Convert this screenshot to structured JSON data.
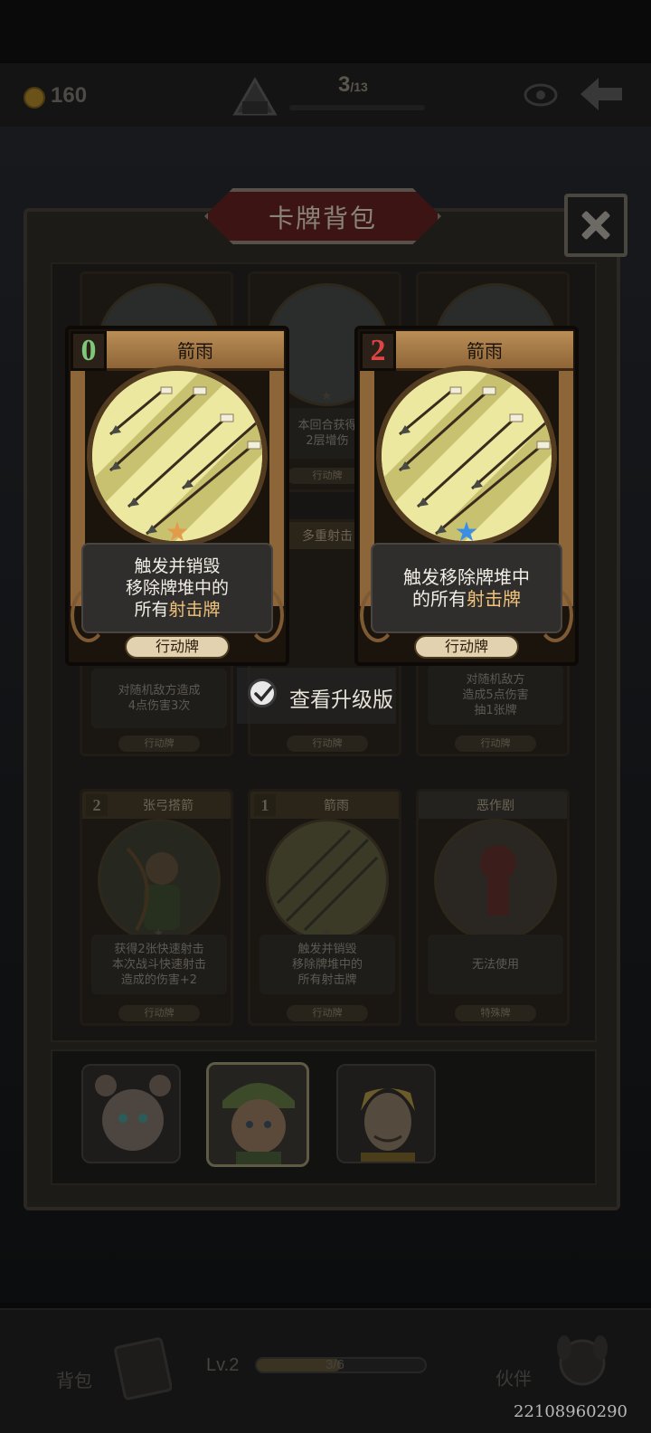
{
  "hud": {
    "coins": "160",
    "floor_current": "3",
    "floor_total": "/13",
    "icons": [
      "coin-icon",
      "map-icon",
      "eye-icon",
      "back-arrow-icon"
    ]
  },
  "panel": {
    "title": "卡牌背包",
    "close_icon": "close-icon"
  },
  "compare_cards": [
    {
      "name": "箭雨",
      "cost": "0",
      "cost_color": "#7ec87a",
      "star_color": "#e39a4a",
      "desc": [
        "触发并销毁",
        "移除牌堆中的",
        "所有"
      ],
      "highlight": "射击牌",
      "type": "行动牌"
    },
    {
      "name": "箭雨",
      "cost": "2",
      "cost_color": "#e04545",
      "star_color": "#3a8ee6",
      "desc": [
        "触发移除牌堆中",
        "的所有"
      ],
      "highlight": "射击牌",
      "type": "行动牌"
    }
  ],
  "upgrade_toggle": {
    "label": "查看升级版",
    "checked": true
  },
  "background_cards": {
    "row1_mid": {
      "desc": [
        "本回合获得",
        "2层增伤"
      ],
      "type": "行动牌"
    },
    "row2_mid_name": "多重射击",
    "row2_left": {
      "desc": [
        "对随机敌方造成",
        "4点伤害3次"
      ],
      "type": "行动牌"
    },
    "row2_mid_type": "行动牌",
    "row2_right": {
      "desc": [
        "对随机敌方",
        "造成5点伤害",
        "抽1张牌"
      ],
      "type": "行动牌"
    }
  },
  "bottom_cards": [
    {
      "cost": "2",
      "name": "张弓搭箭",
      "desc": [
        "获得2张快速射击",
        "本次战斗快速射击",
        "造成的伤害+2"
      ],
      "type": "行动牌"
    },
    {
      "cost": "1",
      "name": "箭雨",
      "desc": [
        "触发并销毁",
        "移除牌堆中的",
        "所有射击牌"
      ],
      "type": "行动牌"
    },
    {
      "cost": "",
      "name": "恶作剧",
      "desc": [
        "无法使用"
      ],
      "type": "特殊牌"
    }
  ],
  "characters": [
    "bear-girl-portrait",
    "archer-boy-portrait",
    "blonde-knight-portrait"
  ],
  "bottom_bar": {
    "bag_label": "背包",
    "level_label": "Lv.2",
    "xp_value": "3/6",
    "xp_fraction": 0.5,
    "partner_label": "伙伴"
  },
  "build_id": "22108960290"
}
